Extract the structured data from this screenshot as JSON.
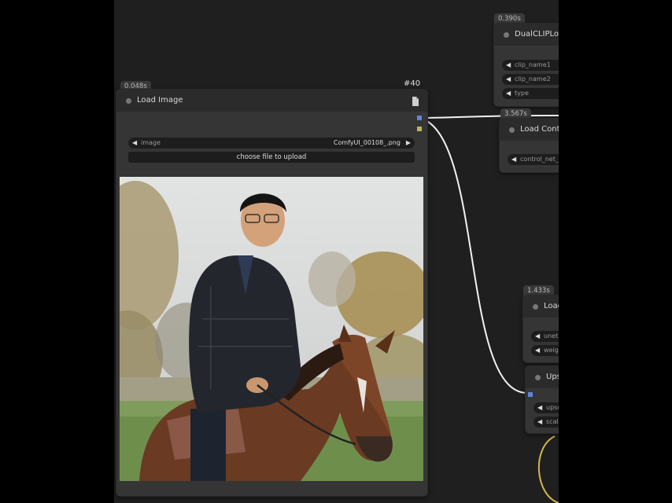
{
  "load_image_node": {
    "timing": "0.048s",
    "node_id": "#40",
    "title": "Load Image",
    "image_widget_label": "image",
    "image_widget_value": "ComfyUI_00108_.png",
    "upload_button_label": "choose file to upload"
  },
  "dual_clip_node": {
    "timing": "0.390s",
    "title": "DualCLIPLoa",
    "widgets": [
      "clip_name1",
      "clip_name2",
      "type"
    ]
  },
  "load_control_node": {
    "timing": "3.567s",
    "title": "Load Contr",
    "widgets": [
      "control_net_"
    ]
  },
  "load_node": {
    "timing": "1.433s",
    "title": "Load",
    "widgets": [
      "unet",
      "weig"
    ]
  },
  "upscale_node": {
    "title": "Ups",
    "widgets": [
      "upsc",
      "scale"
    ]
  },
  "colors": {
    "canvas_bg": "#1f1f1f",
    "node_bg": "#353535",
    "link_white": "#f2f2f2",
    "link_yellow": "#d9b44a",
    "image_socket": "#5b86d9"
  }
}
